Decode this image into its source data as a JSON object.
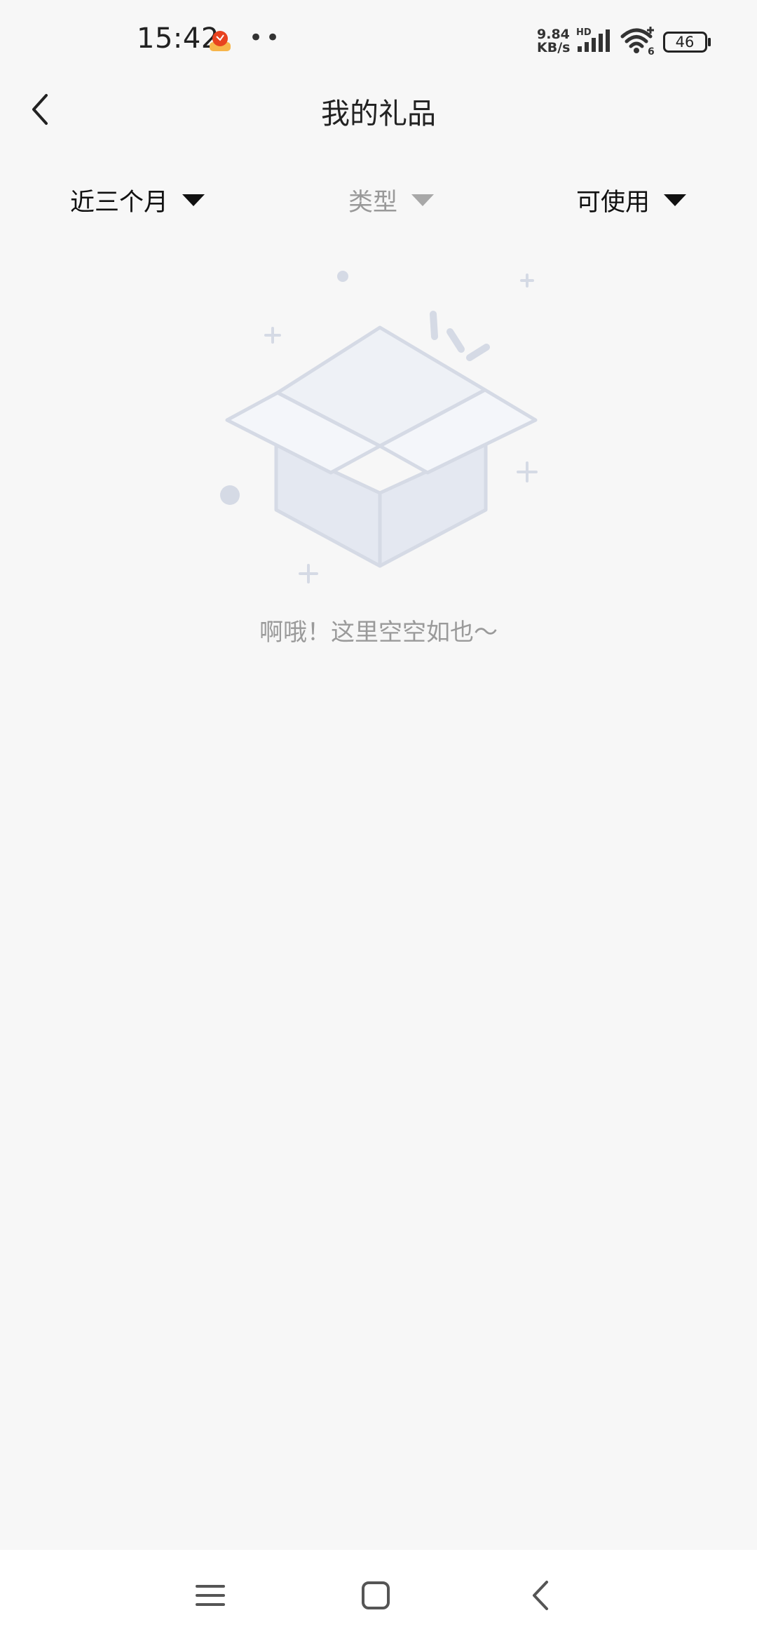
{
  "status_bar": {
    "time": "15:42",
    "dots": "••",
    "net_speed_value": "9.84",
    "net_speed_unit": "KB/s",
    "signal_label": "HD",
    "wifi_label": "6",
    "battery_level": "46",
    "icons": [
      "app-notification-icon",
      "signal-icon",
      "wifi-icon",
      "battery-icon"
    ]
  },
  "header": {
    "title": "我的礼品",
    "back_icon": "back-arrow-icon"
  },
  "filters": {
    "period": "近三个月",
    "type": "类型",
    "status": "可使用"
  },
  "empty_state": {
    "illustration": "empty-box-icon",
    "message": "啊哦！这里空空如也～"
  },
  "nav_bar": {
    "icons": [
      "menu-icon",
      "home-icon",
      "back-icon"
    ]
  },
  "colors": {
    "background": "#f7f7f7",
    "active_text": "#111111",
    "disabled_text": "#999999",
    "illustration": "#d5dae5",
    "nav_bar": "#ffffff"
  }
}
